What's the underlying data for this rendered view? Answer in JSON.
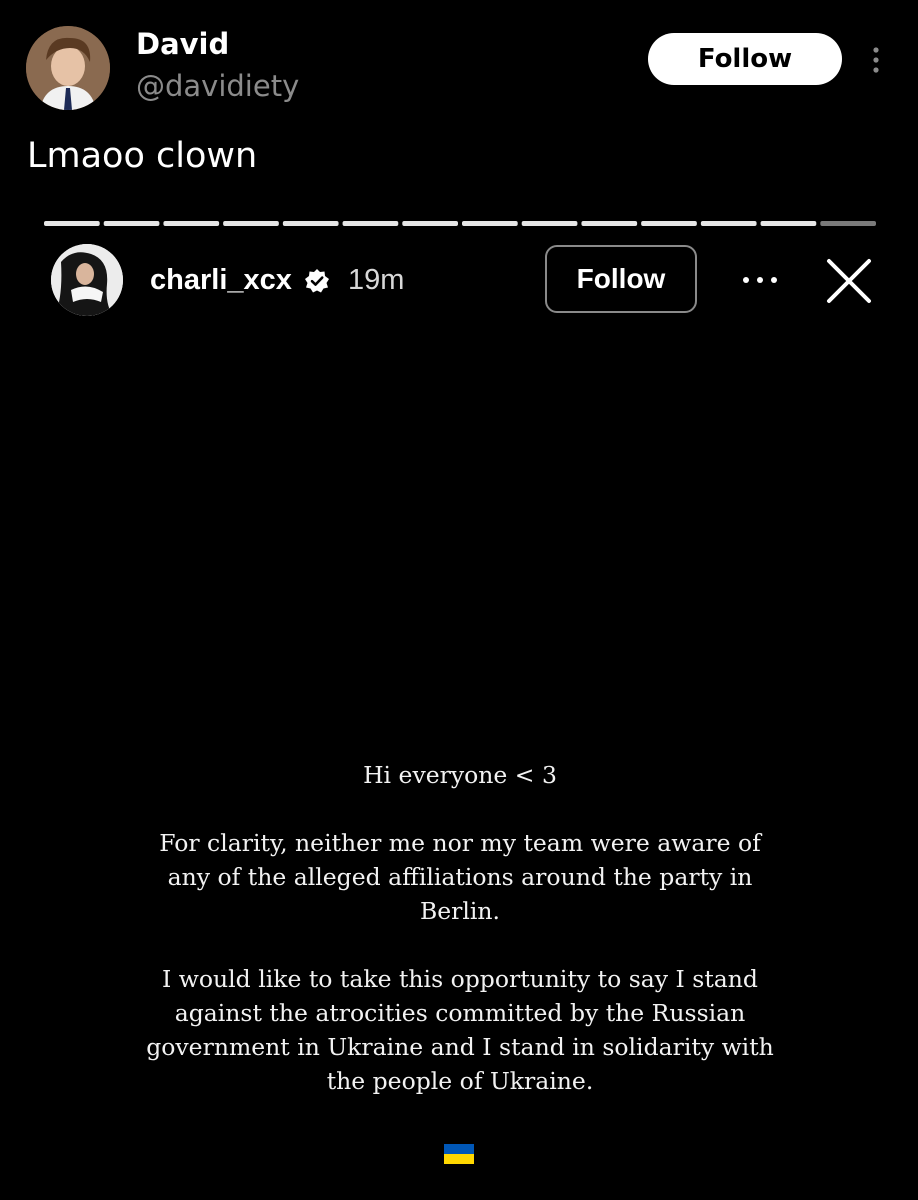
{
  "post": {
    "display_name": "David",
    "handle": "@davidiety",
    "follow_label": "Follow",
    "text": "Lmaoo clown",
    "avatar_icon": "profile-photo",
    "menu_icon": "more-vertical-icon"
  },
  "story": {
    "username": "charli_xcx",
    "verified": true,
    "time": "19m",
    "follow_label": "Follow",
    "progress_segments": 14,
    "more_icon": "more-horizontal-icon",
    "close_icon": "close-icon",
    "statement": {
      "greeting": "Hi everyone < 3",
      "paragraph1": "For clarity, neither me nor my team were aware of any of the alleged affiliations around the party in Berlin.",
      "paragraph2": "I would like to take this opportunity to say I stand against the atrocities committed by the Russian government in Ukraine and I stand in solidarity with the people of Ukraine."
    },
    "flag": {
      "icon": "ukraine-flag-icon",
      "colors": [
        "#0057B7",
        "#FFD700"
      ]
    }
  },
  "colors": {
    "background": "#000000",
    "secondary_text": "#8b8b8b",
    "follow_filled_bg": "#ffffff"
  }
}
